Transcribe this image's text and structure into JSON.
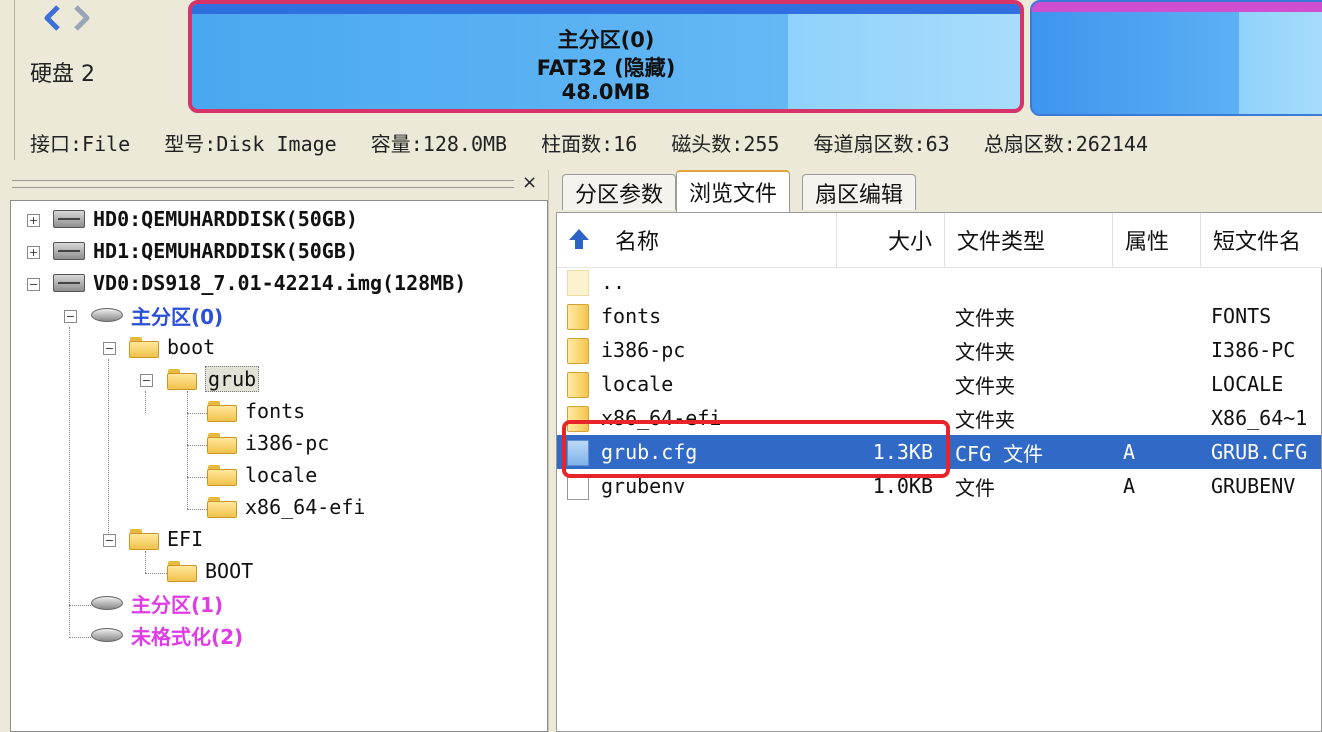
{
  "nav": {
    "back_icon": "chevron-left-icon",
    "forward_icon": "chevron-right-icon"
  },
  "disk_label": "硬盘 2",
  "partition_bar": {
    "selected": {
      "line1": "主分区(0)",
      "line2": "FAT32 (隐藏)",
      "line3": "48.0MB"
    }
  },
  "disk_info": {
    "interface": "接口:File",
    "model": "型号:Disk Image",
    "capacity": "容量:128.0MB",
    "cylinders": "柱面数:16",
    "heads": "磁头数:255",
    "sectors_per_track": "每道扇区数:63",
    "total_sectors": "总扇区数:262144"
  },
  "tree": {
    "close_label": "×",
    "nodes": {
      "hd0": "HD0:QEMUHARDDISK(50GB)",
      "hd1": "HD1:QEMUHARDDISK(50GB)",
      "vd0": "VD0:DS918_7.01-42214.img(128MB)",
      "part0": "主分区(0)",
      "boot": "boot",
      "grub": "grub",
      "fonts": "fonts",
      "i386": "i386-pc",
      "locale": "locale",
      "x86": "x86_64-efi",
      "efi": "EFI",
      "efiboot": "BOOT",
      "part1": "主分区(1)",
      "unformatted": "未格式化(2)"
    },
    "expanders": {
      "plus": "+",
      "minus": "−"
    }
  },
  "tabs": [
    "分区参数",
    "浏览文件",
    "扇区编辑"
  ],
  "file_list": {
    "columns": {
      "name": "名称",
      "size": "大小",
      "type": "文件类型",
      "attr": "属性",
      "short": "短文件名"
    },
    "rows": [
      {
        "name": "..",
        "size": "",
        "type": "",
        "attr": "",
        "short": "",
        "icon": "parent"
      },
      {
        "name": "fonts",
        "size": "",
        "type": "文件夹",
        "attr": "",
        "short": "FONTS",
        "icon": "folder"
      },
      {
        "name": "i386-pc",
        "size": "",
        "type": "文件夹",
        "attr": "",
        "short": "I386-PC",
        "icon": "folder"
      },
      {
        "name": "locale",
        "size": "",
        "type": "文件夹",
        "attr": "",
        "short": "LOCALE",
        "icon": "folder"
      },
      {
        "name": "x86_64-efi",
        "size": "",
        "type": "文件夹",
        "attr": "",
        "short": "X86_64~1",
        "icon": "folder"
      },
      {
        "name": "grub.cfg",
        "size": "1.3KB",
        "type": "CFG 文件",
        "attr": "A",
        "short": "GRUB.CFG",
        "icon": "cfg"
      },
      {
        "name": "grubenv",
        "size": "1.0KB",
        "type": "文件",
        "attr": "A",
        "short": "GRUBENV",
        "icon": "file"
      }
    ]
  },
  "colors": {
    "selection": "#3169c6",
    "highlight_box": "#e8242a",
    "partition_border": "#d6336b"
  }
}
